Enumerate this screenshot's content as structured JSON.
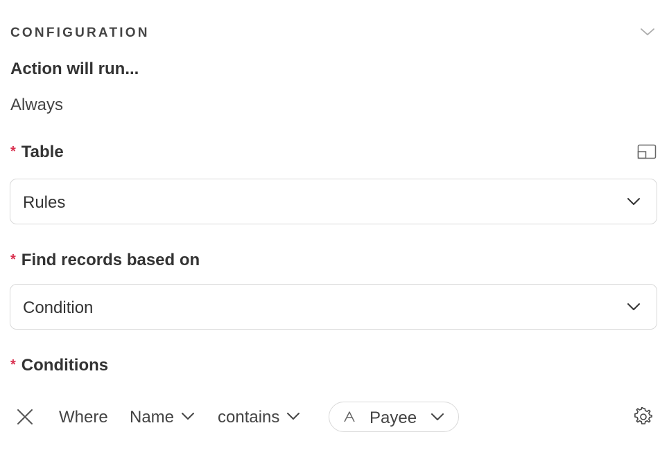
{
  "section": {
    "title": "CONFIGURATION"
  },
  "trigger": {
    "label": "Action will run...",
    "value": "Always"
  },
  "fields": {
    "table": {
      "required_mark": "*",
      "label": "Table",
      "value": "Rules"
    },
    "find_records": {
      "required_mark": "*",
      "label": "Find records based on",
      "value": "Condition"
    },
    "conditions": {
      "required_mark": "*",
      "label": "Conditions",
      "row": {
        "prefix": "Where",
        "field": "Name",
        "operator": "contains",
        "value": "Payee"
      }
    }
  },
  "icons": {
    "collapse": "chevron-down-icon",
    "expand": "expand-panel-icon",
    "remove": "close-icon",
    "value_type": "text-type-icon",
    "settings": "gear-icon"
  },
  "colors": {
    "required": "#d9304f",
    "border": "#d9d9d9",
    "text": "#333333"
  }
}
